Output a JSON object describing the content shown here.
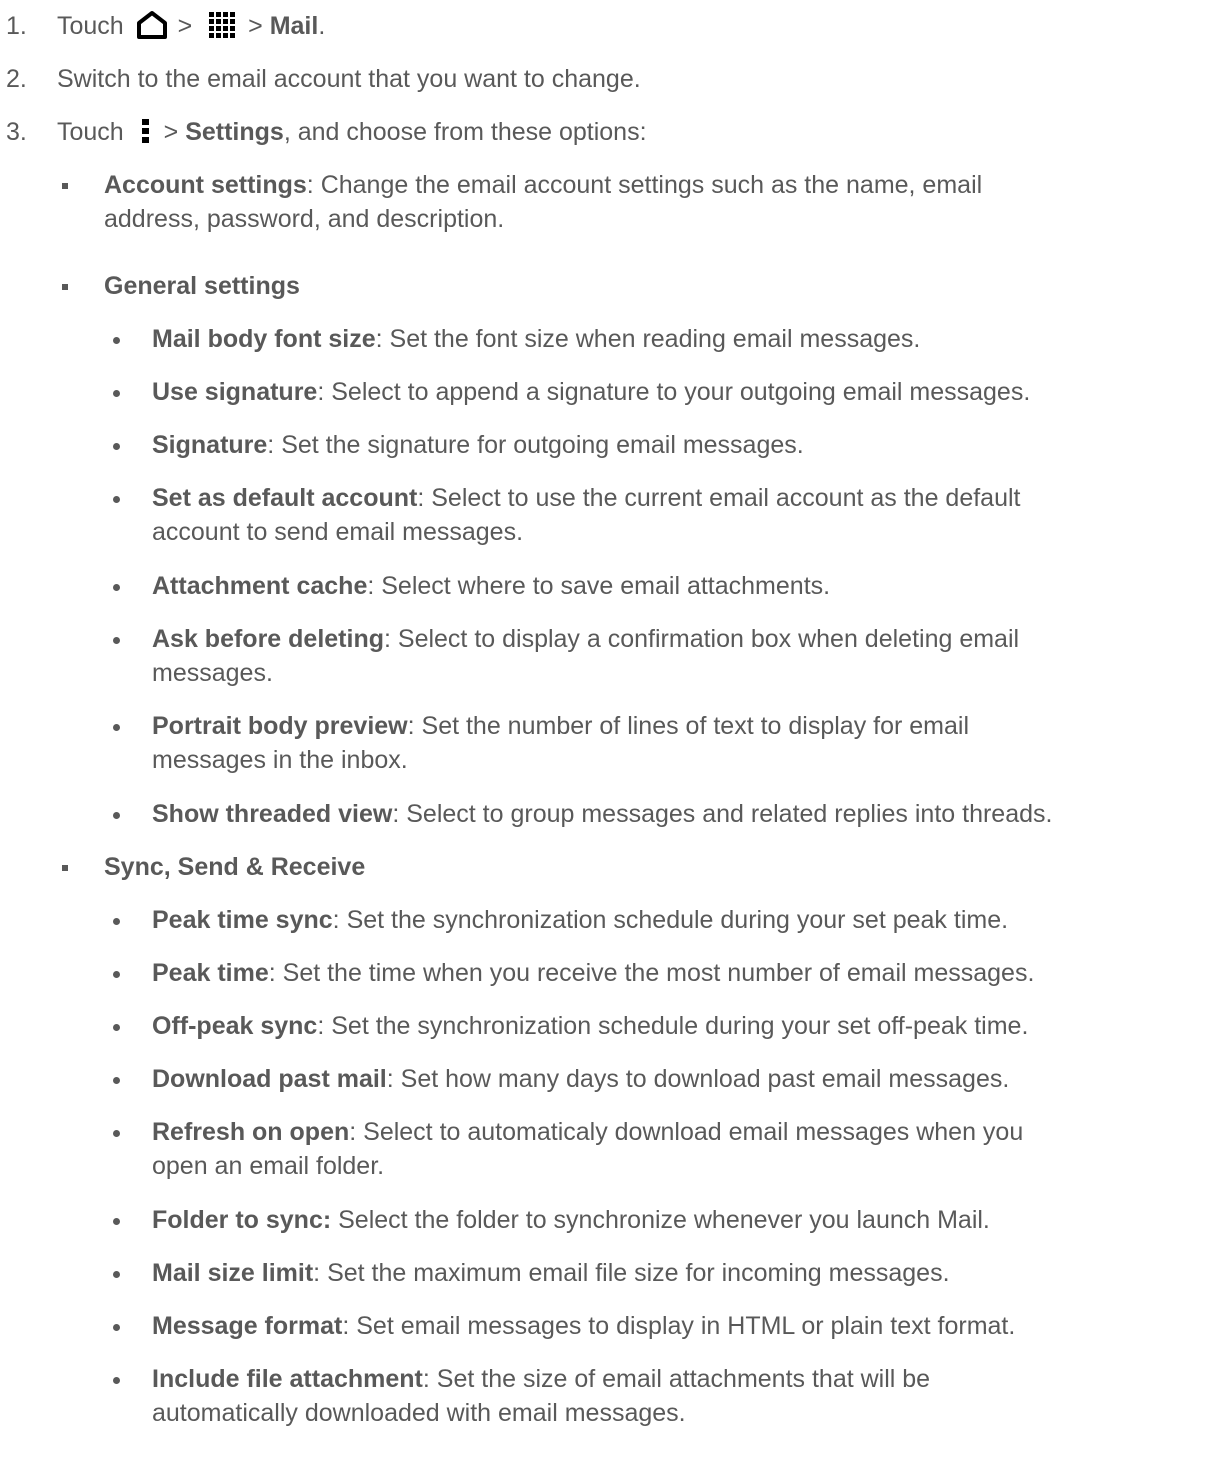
{
  "steps": [
    {
      "number": "1.",
      "lead": "Touch",
      "sep1": ">",
      "sep2": ">",
      "target": "Mail",
      "end": "."
    },
    {
      "number": "2.",
      "text": "Switch to the email account that you want to change."
    },
    {
      "number": "3.",
      "lead": "Touch",
      "sep": ">",
      "target": "Settings",
      "rest": ", and choose from these options:"
    }
  ],
  "icons": {
    "step1_first": "home-icon",
    "step1_second": "apps-grid-icon",
    "step3": "more-menu-icon"
  },
  "account_settings": {
    "title": "Account settings",
    "line1": ": Change the email account settings such as the name, email",
    "line2": "address, password, and description."
  },
  "general_settings": {
    "title": "General settings",
    "items": [
      {
        "term": "Mail body font size",
        "desc": ": Set the font size when reading email messages."
      },
      {
        "term": "Use signature",
        "desc": ": Select to append a signature to your outgoing email messages."
      },
      {
        "term": "Signature",
        "desc": ": Set the signature for outgoing email messages."
      },
      {
        "term": "Set as default account",
        "desc": ": Select to use the current email account as the default",
        "desc2": "account to send email messages."
      },
      {
        "term": "Attachment cache",
        "desc": ": Select where to save email attachments."
      },
      {
        "term": "Ask before deleting",
        "desc": ": Select to display a confirmation box when deleting email",
        "desc2": "messages."
      },
      {
        "term": "Portrait body preview",
        "desc": ": Set the number of lines of text to display for email",
        "desc2": "messages in the inbox."
      },
      {
        "term": "Show threaded view",
        "desc": ": Select to group messages and related replies into threads."
      }
    ]
  },
  "sync_settings": {
    "title": "Sync, Send & Receive",
    "items": [
      {
        "term": "Peak time sync",
        "desc": ": Set the synchronization schedule during your set peak time."
      },
      {
        "term": "Peak time",
        "desc": ": Set the time when you receive the most number of email messages."
      },
      {
        "term": "Off-peak sync",
        "desc": ": Set the synchronization schedule during your set off-peak time."
      },
      {
        "term": "Download past mail",
        "desc": ": Set how many days to download past email messages."
      },
      {
        "term": "Refresh on open",
        "desc": ": Select to automaticaly download email messages when you",
        "desc2": "open an email folder."
      },
      {
        "term": "Folder to sync:",
        "desc": " Select the folder to synchronize whenever you launch Mail."
      },
      {
        "term": "Mail size limit",
        "desc": ": Set the maximum email file size for incoming messages."
      },
      {
        "term": "Message format",
        "desc": ": Set email messages to display in HTML or plain text format."
      },
      {
        "term": "Include file attachment",
        "desc": ": Set the size of email attachments that will be",
        "desc2": "automatically downloaded with email messages."
      }
    ]
  }
}
